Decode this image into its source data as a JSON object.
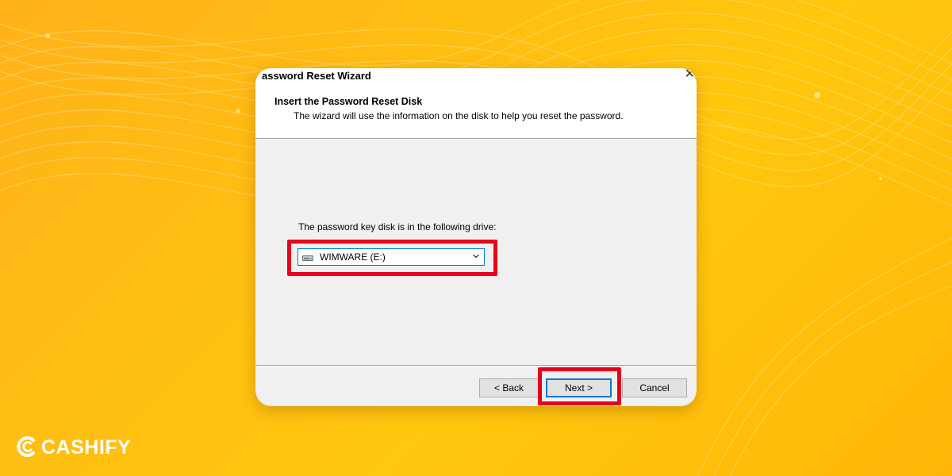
{
  "window": {
    "title": "assword Reset Wizard",
    "close_glyph": "✕"
  },
  "header": {
    "title": "Insert the Password Reset Disk",
    "subtitle": "The wizard will use the information on the disk to help you reset the password."
  },
  "body": {
    "drive_label": "The password key disk is in the following drive:",
    "drive_select": {
      "value": "WIMWARE (E:)",
      "icon": "drive-icon"
    }
  },
  "buttons": {
    "back": "< Back",
    "next": "Next >",
    "cancel": "Cancel"
  },
  "brand": {
    "logo_text": "CASHIFY"
  },
  "colors": {
    "background": "#ffbe12",
    "highlight": "#e8001c",
    "focus": "#0078d7"
  }
}
